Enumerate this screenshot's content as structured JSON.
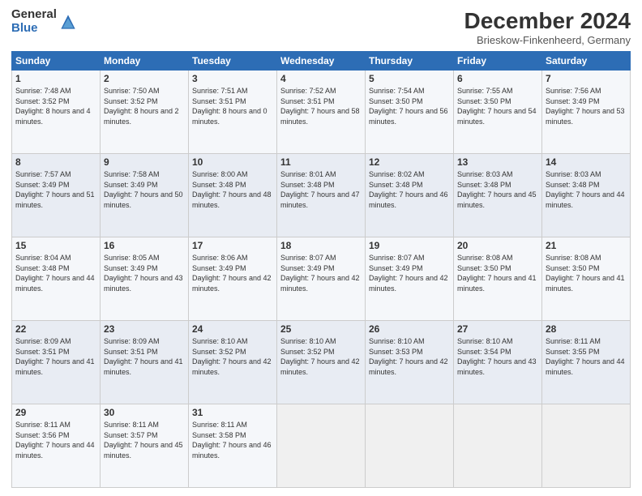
{
  "logo": {
    "general": "General",
    "blue": "Blue"
  },
  "header": {
    "title": "December 2024",
    "subtitle": "Brieskow-Finkenheerd, Germany"
  },
  "days_of_week": [
    "Sunday",
    "Monday",
    "Tuesday",
    "Wednesday",
    "Thursday",
    "Friday",
    "Saturday"
  ],
  "weeks": [
    [
      {
        "day": "1",
        "sunrise": "7:48 AM",
        "sunset": "3:52 PM",
        "daylight": "8 hours and 4 minutes."
      },
      {
        "day": "2",
        "sunrise": "7:50 AM",
        "sunset": "3:52 PM",
        "daylight": "8 hours and 2 minutes."
      },
      {
        "day": "3",
        "sunrise": "7:51 AM",
        "sunset": "3:51 PM",
        "daylight": "8 hours and 0 minutes."
      },
      {
        "day": "4",
        "sunrise": "7:52 AM",
        "sunset": "3:51 PM",
        "daylight": "7 hours and 58 minutes."
      },
      {
        "day": "5",
        "sunrise": "7:54 AM",
        "sunset": "3:50 PM",
        "daylight": "7 hours and 56 minutes."
      },
      {
        "day": "6",
        "sunrise": "7:55 AM",
        "sunset": "3:50 PM",
        "daylight": "7 hours and 54 minutes."
      },
      {
        "day": "7",
        "sunrise": "7:56 AM",
        "sunset": "3:49 PM",
        "daylight": "7 hours and 53 minutes."
      }
    ],
    [
      {
        "day": "8",
        "sunrise": "7:57 AM",
        "sunset": "3:49 PM",
        "daylight": "7 hours and 51 minutes."
      },
      {
        "day": "9",
        "sunrise": "7:58 AM",
        "sunset": "3:49 PM",
        "daylight": "7 hours and 50 minutes."
      },
      {
        "day": "10",
        "sunrise": "8:00 AM",
        "sunset": "3:48 PM",
        "daylight": "7 hours and 48 minutes."
      },
      {
        "day": "11",
        "sunrise": "8:01 AM",
        "sunset": "3:48 PM",
        "daylight": "7 hours and 47 minutes."
      },
      {
        "day": "12",
        "sunrise": "8:02 AM",
        "sunset": "3:48 PM",
        "daylight": "7 hours and 46 minutes."
      },
      {
        "day": "13",
        "sunrise": "8:03 AM",
        "sunset": "3:48 PM",
        "daylight": "7 hours and 45 minutes."
      },
      {
        "day": "14",
        "sunrise": "8:03 AM",
        "sunset": "3:48 PM",
        "daylight": "7 hours and 44 minutes."
      }
    ],
    [
      {
        "day": "15",
        "sunrise": "8:04 AM",
        "sunset": "3:48 PM",
        "daylight": "7 hours and 44 minutes."
      },
      {
        "day": "16",
        "sunrise": "8:05 AM",
        "sunset": "3:49 PM",
        "daylight": "7 hours and 43 minutes."
      },
      {
        "day": "17",
        "sunrise": "8:06 AM",
        "sunset": "3:49 PM",
        "daylight": "7 hours and 42 minutes."
      },
      {
        "day": "18",
        "sunrise": "8:07 AM",
        "sunset": "3:49 PM",
        "daylight": "7 hours and 42 minutes."
      },
      {
        "day": "19",
        "sunrise": "8:07 AM",
        "sunset": "3:49 PM",
        "daylight": "7 hours and 42 minutes."
      },
      {
        "day": "20",
        "sunrise": "8:08 AM",
        "sunset": "3:50 PM",
        "daylight": "7 hours and 41 minutes."
      },
      {
        "day": "21",
        "sunrise": "8:08 AM",
        "sunset": "3:50 PM",
        "daylight": "7 hours and 41 minutes."
      }
    ],
    [
      {
        "day": "22",
        "sunrise": "8:09 AM",
        "sunset": "3:51 PM",
        "daylight": "7 hours and 41 minutes."
      },
      {
        "day": "23",
        "sunrise": "8:09 AM",
        "sunset": "3:51 PM",
        "daylight": "7 hours and 41 minutes."
      },
      {
        "day": "24",
        "sunrise": "8:10 AM",
        "sunset": "3:52 PM",
        "daylight": "7 hours and 42 minutes."
      },
      {
        "day": "25",
        "sunrise": "8:10 AM",
        "sunset": "3:52 PM",
        "daylight": "7 hours and 42 minutes."
      },
      {
        "day": "26",
        "sunrise": "8:10 AM",
        "sunset": "3:53 PM",
        "daylight": "7 hours and 42 minutes."
      },
      {
        "day": "27",
        "sunrise": "8:10 AM",
        "sunset": "3:54 PM",
        "daylight": "7 hours and 43 minutes."
      },
      {
        "day": "28",
        "sunrise": "8:11 AM",
        "sunset": "3:55 PM",
        "daylight": "7 hours and 44 minutes."
      }
    ],
    [
      {
        "day": "29",
        "sunrise": "8:11 AM",
        "sunset": "3:56 PM",
        "daylight": "7 hours and 44 minutes."
      },
      {
        "day": "30",
        "sunrise": "8:11 AM",
        "sunset": "3:57 PM",
        "daylight": "7 hours and 45 minutes."
      },
      {
        "day": "31",
        "sunrise": "8:11 AM",
        "sunset": "3:58 PM",
        "daylight": "7 hours and 46 minutes."
      },
      null,
      null,
      null,
      null
    ]
  ]
}
